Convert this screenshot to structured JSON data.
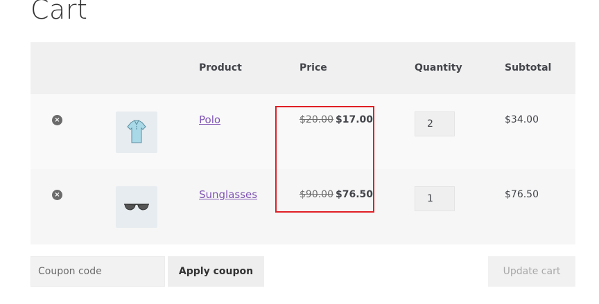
{
  "page": {
    "title": "Cart"
  },
  "table": {
    "headers": {
      "product": "Product",
      "price": "Price",
      "quantity": "Quantity",
      "subtotal": "Subtotal"
    },
    "rows": [
      {
        "remove_symbol": "×",
        "thumbnail_icon": "polo-shirt-icon",
        "product": "Polo",
        "old_price": "$20.00",
        "sale_price": "$17.00",
        "quantity": "2",
        "subtotal": "$34.00"
      },
      {
        "remove_symbol": "×",
        "thumbnail_icon": "sunglasses-icon",
        "product": "Sunglasses",
        "old_price": "$90.00",
        "sale_price": "$76.50",
        "quantity": "1",
        "subtotal": "$76.50"
      }
    ]
  },
  "actions": {
    "coupon_placeholder": "Coupon code",
    "apply_coupon": "Apply coupon",
    "update_cart": "Update cart"
  },
  "colors": {
    "link": "#7f54b3",
    "highlight": "#e01e24"
  }
}
